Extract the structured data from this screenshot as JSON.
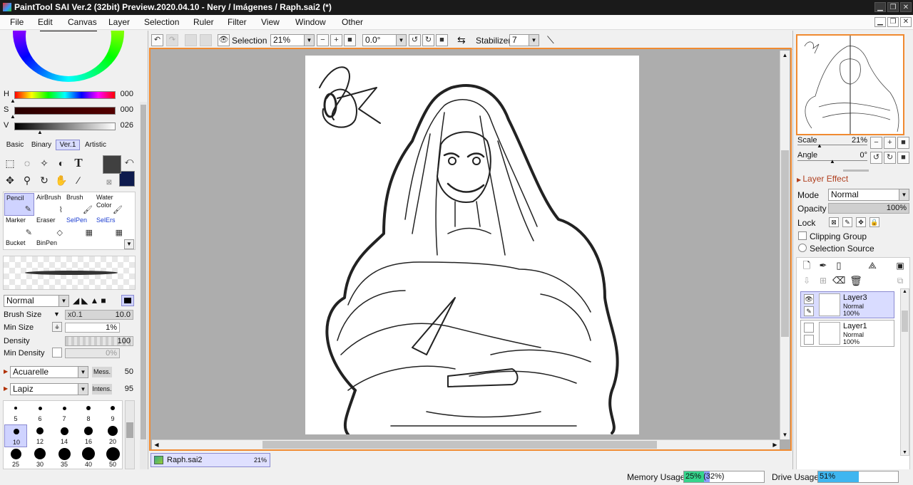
{
  "titlebar": {
    "title": "PaintTool SAI Ver.2 (32bit) Preview.2020.04.10 - Nery / Imágenes / Raph.sai2 (*)",
    "minimize": "▁",
    "restore": "❐",
    "close": "✕"
  },
  "menu": [
    "File",
    "Edit",
    "Canvas",
    "Layer",
    "Selection",
    "Ruler",
    "Filter",
    "View",
    "Window",
    "Other"
  ],
  "mdi_controls": {
    "minimize": "▁",
    "restore": "❐",
    "close": "✕"
  },
  "color": {
    "h_label": "H",
    "h_value": "000",
    "s_label": "S",
    "s_value": "000",
    "v_label": "V",
    "v_value": "026",
    "tabs": [
      "Basic",
      "Binary",
      "Ver.1",
      "Artistic"
    ],
    "active_tab": "Ver.1",
    "primary": "#404040",
    "secondary": "#0d1a4d"
  },
  "brushes": [
    {
      "name": "Pencil",
      "icon": "✎"
    },
    {
      "name": "AirBrush",
      "icon": "⌇"
    },
    {
      "name": "Brush",
      "icon": "🖌"
    },
    {
      "name": "Water\nColor",
      "icon": "🖌"
    },
    {
      "name": "Marker",
      "icon": "✎"
    },
    {
      "name": "Eraser",
      "icon": "◇"
    },
    {
      "name": "SelPen",
      "icon": "▦"
    },
    {
      "name": "SelErs",
      "icon": "▦"
    },
    {
      "name": "Bucket",
      "icon": ""
    },
    {
      "name": "BinPen",
      "icon": ""
    }
  ],
  "brush_props": {
    "blend_mode": "Normal",
    "size_label": "Brush Size",
    "size_mult": "x0.1",
    "size_value": "10.0",
    "min_size_label": "Min Size",
    "min_size_value": "1%",
    "density_label": "Density",
    "density_value": "100",
    "min_density_label": "Min Density",
    "min_density_value": "0%",
    "texture": "Acuarelle",
    "texture_param_label": "Mess.",
    "texture_param_value": "50",
    "shape": "Lapiz",
    "shape_param_label": "Intens.",
    "shape_param_value": "95"
  },
  "sizes": [
    "5",
    "6",
    "7",
    "8",
    "9",
    "10",
    "12",
    "14",
    "16",
    "20",
    "25",
    "30",
    "35",
    "40",
    "50"
  ],
  "toolbar": {
    "selection_label": "Selection",
    "zoom": "21%",
    "angle": "0.0°",
    "stabilizer_label": "Stabilizer",
    "stabilizer_value": "7"
  },
  "doc_tab": {
    "name": "Raph.sai2",
    "zoom": "21%"
  },
  "navigator": {
    "scale_label": "Scale",
    "scale_value": "21%",
    "angle_label": "Angle",
    "angle_value": "0°"
  },
  "layer_panel": {
    "layer_effect": "Layer Effect",
    "mode_label": "Mode",
    "mode_value": "Normal",
    "opacity_label": "Opacity",
    "opacity_value": "100%",
    "lock_label": "Lock",
    "clipping_group": "Clipping Group",
    "selection_source": "Selection Source",
    "layers": [
      {
        "name": "Layer3",
        "mode": "Normal",
        "opacity": "100%",
        "visible": true,
        "selected": true
      },
      {
        "name": "Layer1",
        "mode": "Normal",
        "opacity": "100%",
        "visible": false,
        "selected": false
      }
    ]
  },
  "status": {
    "memory_label": "Memory Usage",
    "memory_text": "25% (32%)",
    "memory_fraction": 0.25,
    "drive_label": "Drive Usage",
    "drive_text": "51%",
    "drive_fraction": 0.51
  }
}
